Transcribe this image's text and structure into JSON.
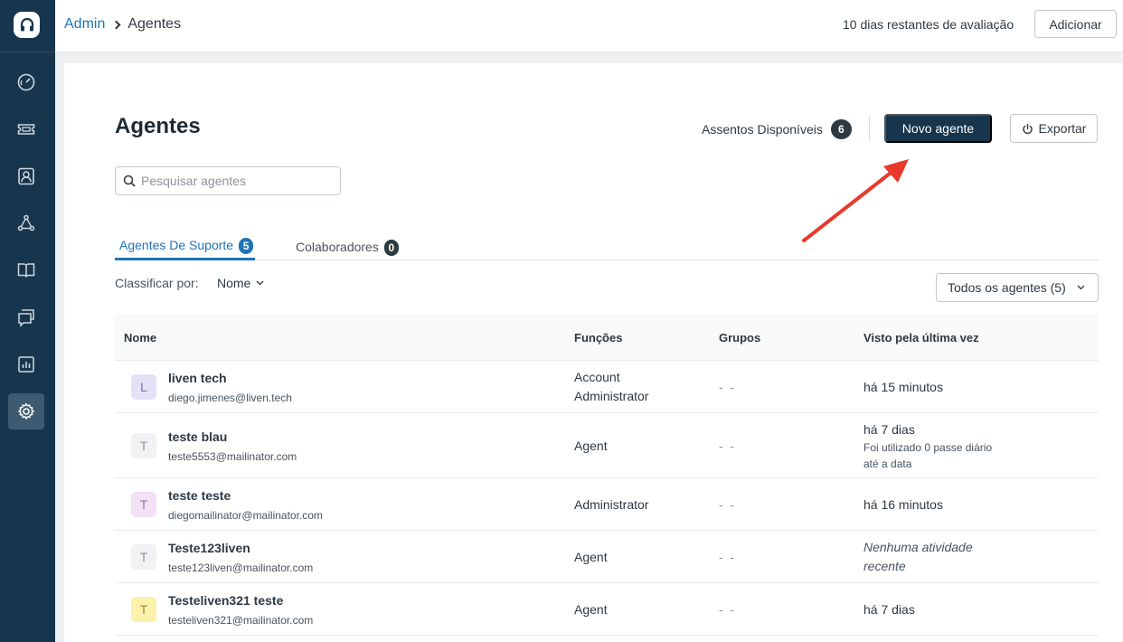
{
  "sidebar": {
    "logo_icon": "headset-icon",
    "items": [
      {
        "icon": "dashboard-icon",
        "active": false
      },
      {
        "icon": "ticket-icon",
        "active": false
      },
      {
        "icon": "contact-icon",
        "active": false
      },
      {
        "icon": "network-icon",
        "active": false
      },
      {
        "icon": "book-icon",
        "active": false
      },
      {
        "icon": "chat-icon",
        "active": false
      },
      {
        "icon": "reports-icon",
        "active": false
      },
      {
        "icon": "gear-icon",
        "active": true
      }
    ]
  },
  "header": {
    "breadcrumb_root": "Admin",
    "breadcrumb_current": "Agentes",
    "trial_text": "10 dias restantes de avaliação",
    "add_label": "Adicionar"
  },
  "page": {
    "title": "Agentes",
    "seats_label": "Assentos Disponíveis",
    "seats_count": "6",
    "new_agent_label": "Novo agente",
    "export_label": "Exportar",
    "search_placeholder": "Pesquisar agentes"
  },
  "tabs": [
    {
      "label": "Agentes De Suporte",
      "count": "5",
      "active": true
    },
    {
      "label": "Colaboradores",
      "count": "0",
      "active": false
    }
  ],
  "sort": {
    "label": "Classificar por:",
    "value": "Nome",
    "filter_label": "Todos os agentes (5)"
  },
  "table": {
    "columns": [
      "Nome",
      "Funções",
      "Grupos",
      "Visto pela última vez"
    ],
    "rows": [
      {
        "initial": "L",
        "name": "liven tech",
        "email": "diego.jimenes@liven.tech",
        "role_line1": "Account",
        "role_line2": "Administrator",
        "groups": "- -",
        "seen": "há 15 minutos",
        "seen_sub1": "",
        "seen_sub2": "",
        "avatar_bg": "#e5e0f5",
        "avatar_fg": "#7a6fa8"
      },
      {
        "initial": "T",
        "name": "teste blau",
        "email": "teste5553@mailinator.com",
        "role_line1": "Agent",
        "role_line2": "",
        "groups": "- -",
        "seen": "há 7 dias",
        "seen_sub1": "Foi utilizado 0 passe diário",
        "seen_sub2": "até a data",
        "avatar_bg": "#f1f2f3",
        "avatar_fg": "#8c959c"
      },
      {
        "initial": "T",
        "name": "teste teste",
        "email": "diegomailinator@mailinator.com",
        "role_line1": "Administrator",
        "role_line2": "",
        "groups": "- -",
        "seen": "há 16 minutos",
        "seen_sub1": "",
        "seen_sub2": "",
        "avatar_bg": "#f3e1f7",
        "avatar_fg": "#9a6fa8"
      },
      {
        "initial": "T",
        "name": "Teste123liven",
        "email": "teste123liven@mailinator.com",
        "role_line1": "Agent",
        "role_line2": "",
        "groups": "- -",
        "seen_italic1": "Nenhuma atividade",
        "seen_italic2": "recente",
        "avatar_bg": "#f1f2f3",
        "avatar_fg": "#8c959c"
      },
      {
        "initial": "T",
        "name": "Testeliven321 teste",
        "email": "testeliven321@mailinator.com",
        "role_line1": "Agent",
        "role_line2": "",
        "groups": "- -",
        "seen": "há 7 dias",
        "seen_sub1": "",
        "seen_sub2": "",
        "avatar_bg": "#fbf1a9",
        "avatar_fg": "#9a8a3a"
      }
    ]
  },
  "colors": {
    "sidebar_bg": "#17364e",
    "primary_button": "#17364e",
    "link_blue": "#1f73b7",
    "annotation_arrow": "#e8392b"
  }
}
